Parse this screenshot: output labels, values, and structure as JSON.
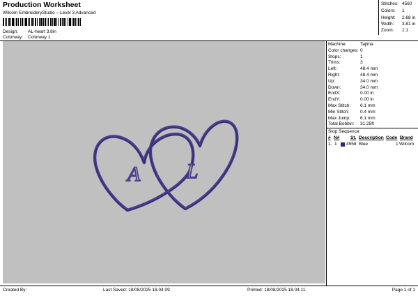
{
  "header": {
    "title": "Production Worksheet",
    "subtitle": "Wilcom EmbroideryStudio – Level 3 Advanced",
    "design_label": "Design:",
    "design_value": "AL-heart 3.8in",
    "colorway_label": "Colorway:",
    "colorway_value": "Colorway 1"
  },
  "summary": {
    "stitches_label": "Stitches:",
    "stitches_value": "4560",
    "colors_label": "Colors:",
    "colors_value": "1",
    "height_label": "Height:",
    "height_value": "2.68 in",
    "width_label": "Width:",
    "width_value": "3.81 in",
    "zoom_label": "Zoom:",
    "zoom_value": "1:1"
  },
  "details": [
    {
      "label": "Machine:",
      "value": "Tajima"
    },
    {
      "label": "Color changes:",
      "value": "0"
    },
    {
      "label": "Stops:",
      "value": "1"
    },
    {
      "label": "Trims:",
      "value": "3"
    },
    {
      "label": "Left:",
      "value": "48.4 mm"
    },
    {
      "label": "Right:",
      "value": "48.4 mm"
    },
    {
      "label": "Up:",
      "value": "34.0 mm"
    },
    {
      "label": "Down:",
      "value": "34.0 mm"
    },
    {
      "label": "EndX:",
      "value": "0.00 in"
    },
    {
      "label": "EndY:",
      "value": "0.00 in"
    },
    {
      "label": "Max Stitch:",
      "value": "6.1 mm"
    },
    {
      "label": "Min Stitch:",
      "value": "0.4 mm"
    },
    {
      "label": "Max Jump:",
      "value": "6.1 mm"
    },
    {
      "label": "Total Bobbin:",
      "value": "31.25ft"
    }
  ],
  "stop_sequence": {
    "label": "Stop Sequence:",
    "headers": {
      "num": "#",
      "n": "N#",
      "st": "St.",
      "description": "Description",
      "code": "Code",
      "brand": "Brand"
    },
    "rows": [
      {
        "num": "1.",
        "n": "1",
        "swatch_color": "#2e2a6b",
        "st": "4558",
        "description": "Blue",
        "code": "1",
        "brand": "Wilcom"
      }
    ]
  },
  "design": {
    "letter_left": "A",
    "letter_right": "L",
    "thread_color": "#4a3f8c",
    "background": "#c0c0c0"
  },
  "footer": {
    "created_by": "Created By:",
    "last_saved": "Last Saved: 18/08/2025 18.04.09",
    "printed": "Printed: 18/08/2025 18.04.11",
    "page": "Page 1 of 1"
  }
}
